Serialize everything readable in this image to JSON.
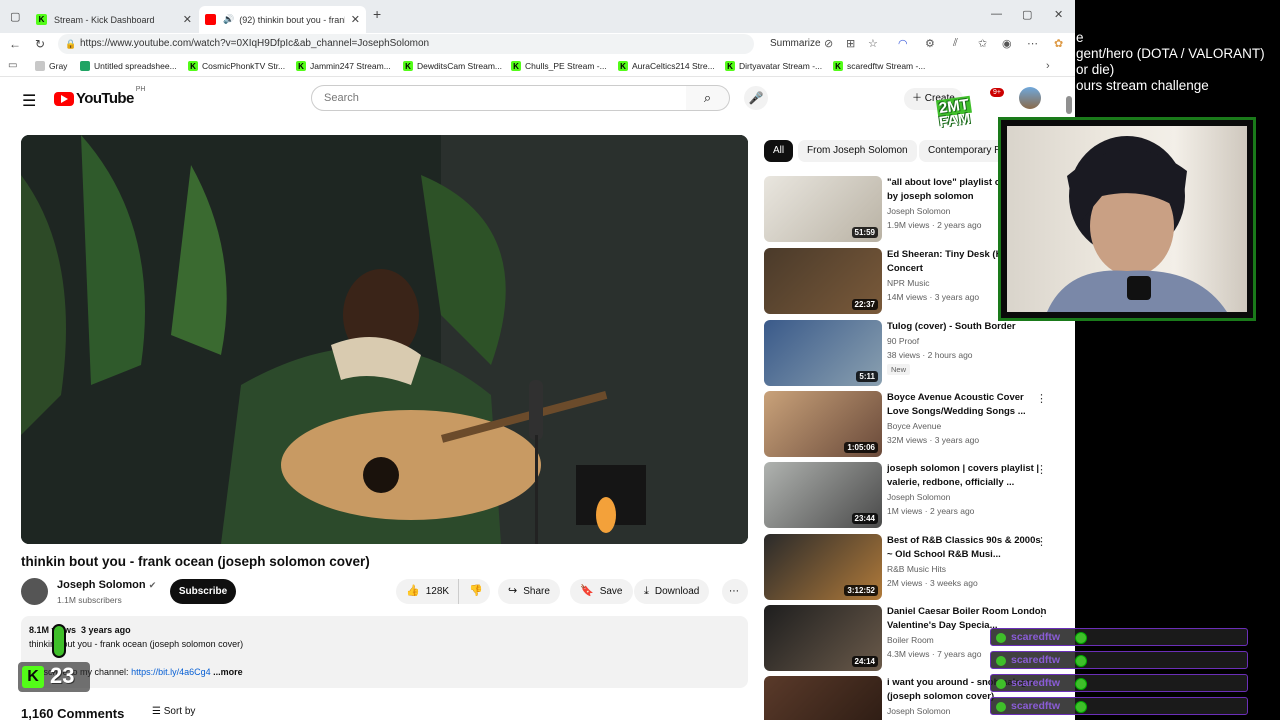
{
  "browser": {
    "tabs": [
      {
        "label": "Stream - Kick Dashboard"
      },
      {
        "label": "(92) thinkin bout you - frank"
      }
    ],
    "url": "https://www.youtube.com/watch?v=0XIqH9DfpIc&ab_channel=JosephSolomon",
    "summarize_label": "Summarize",
    "bookmarks": [
      {
        "label": "Gray",
        "icon": "folder-icon"
      },
      {
        "label": "Untitled spreadshee...",
        "icon": "sheets-icon"
      },
      {
        "label": "CosmicPhonkTV Str...",
        "icon": "kick-icon"
      },
      {
        "label": "Jammin247 Stream...",
        "icon": "kick-icon"
      },
      {
        "label": "DewditsCam Stream...",
        "icon": "kick-icon"
      },
      {
        "label": "Chulls_PE Stream -...",
        "icon": "kick-icon"
      },
      {
        "label": "AuraCeltics214 Stre...",
        "icon": "kick-icon"
      },
      {
        "label": "Dirtyavatar Stream -...",
        "icon": "kick-icon"
      },
      {
        "label": "scaredftw Stream -...",
        "icon": "kick-icon"
      }
    ]
  },
  "youtube": {
    "logo_text": "YouTube",
    "region": "PH",
    "search_placeholder": "Search",
    "create_label": "Create",
    "notif_count": "9+",
    "video": {
      "title": "thinkin bout you - frank ocean (joseph solomon cover)",
      "channel": "Joseph Solomon",
      "subscribers": "1.1M subscribers",
      "subscribe_label": "Subscribe",
      "likes": "128K",
      "share_label": "Share",
      "save_label": "Save",
      "download_label": "Download",
      "views": "8.1M views",
      "age": "3 years ago",
      "desc_line1": "thinkin bout you - frank ocean (joseph solomon cover)",
      "desc_line2_prefix": "subscribe to my channel: ",
      "desc_link": "https://bit.ly/4a6Cg4",
      "more_label": "...more",
      "comments_count": "1,160 Comments",
      "sort_label": "Sort by"
    },
    "chips": [
      "All",
      "From Joseph Solomon",
      "Contemporary R&B"
    ],
    "recommendations": [
      {
        "title": "\"all about love\" playlist of covers by joseph solomon",
        "channel": "Joseph Solomon",
        "meta": "1.9M views · 2 years ago",
        "duration": "51:59",
        "verified": true
      },
      {
        "title": "Ed Sheeran: Tiny Desk (Home) Concert",
        "channel": "NPR Music",
        "meta": "14M views · 3 years ago",
        "duration": "22:37",
        "verified": true
      },
      {
        "title": "Tulog (cover) - South Border",
        "channel": "90 Proof",
        "meta": "38 views · 2 hours ago",
        "duration": "5:11",
        "badge": "New",
        "verified": false
      },
      {
        "title": "Boyce Avenue Acoustic Cover Love Songs/Wedding Songs ...",
        "channel": "Boyce Avenue",
        "meta": "32M views · 3 years ago",
        "duration": "1:05:06",
        "verified": true
      },
      {
        "title": "joseph solomon | covers playlist | valerie, redbone, officially ...",
        "channel": "Joseph Solomon",
        "meta": "1M views · 2 years ago",
        "duration": "23:44",
        "verified": true
      },
      {
        "title": "Best of R&B Classics 90s & 2000s ~ Old School R&B Musi...",
        "channel": "R&B Music Hits",
        "meta": "2M views · 3 weeks ago",
        "duration": "3:12:52",
        "verified": false
      },
      {
        "title": "Daniel Caesar Boiler Room London Valentine's Day Specia...",
        "channel": "Boiler Room",
        "meta": "4.3M views · 7 years ago",
        "duration": "24:14",
        "verified": true
      },
      {
        "title": "i want you around - snoh aalegra (joseph solomon cover)",
        "channel": "Joseph Solomon",
        "meta": "",
        "duration": "",
        "verified": true
      }
    ]
  },
  "stream_overlay": {
    "text_lines": [
      "e",
      "gent/hero (DOTA / VALORANT)",
      " or die)",
      "ours stream challenge"
    ],
    "fam_logo": [
      "2MT",
      "FAM"
    ],
    "chat_user": "scaredftw",
    "chat_rows": 4,
    "kick_count": "23",
    "colors": {
      "kick_green": "#53fc18",
      "chat_purple": "#8a5cd6"
    }
  }
}
